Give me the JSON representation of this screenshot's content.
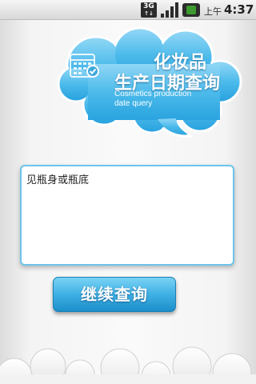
{
  "status_bar": {
    "network_label": "3G",
    "ampm": "上午",
    "time": "4:37",
    "icons": [
      "network-3g-icon",
      "signal-icon",
      "battery-icon"
    ]
  },
  "header": {
    "title_line1": "化妆品",
    "title_line2": "生产日期查询",
    "subtitle_line1": "Cosmetics production",
    "subtitle_line2": "date query",
    "icon": "calendar-check-icon"
  },
  "input": {
    "value": "见瓶身或瓶底"
  },
  "actions": {
    "continue_query_label": "继续查询"
  },
  "colors": {
    "accent": "#3fb0e4",
    "cloud": "#5cc0ec",
    "border": "#6cc4ea"
  }
}
